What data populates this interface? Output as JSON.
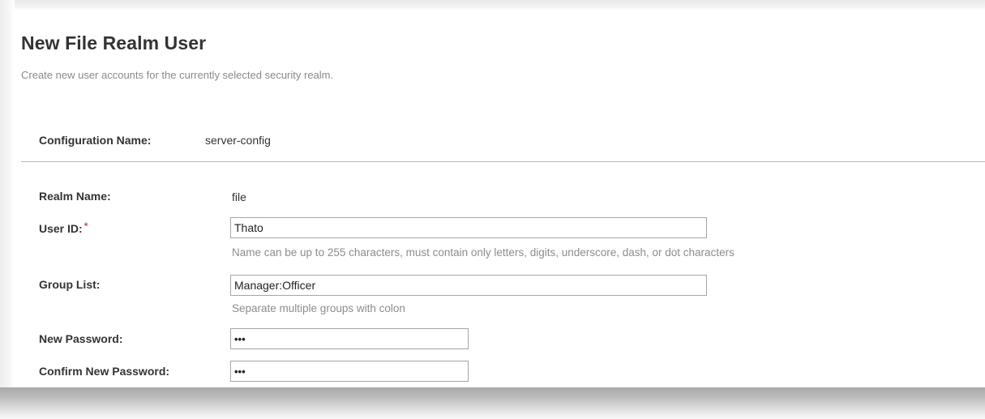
{
  "page": {
    "title": "New File Realm User",
    "description": "Create new user accounts for the currently selected security realm."
  },
  "configuration": {
    "label": "Configuration Name:",
    "value": "server-config"
  },
  "form": {
    "realm_name": {
      "label": "Realm Name:",
      "value": "file"
    },
    "user_id": {
      "label": "User ID:",
      "required_marker": "*",
      "value": "Thato",
      "help": "Name can be up to 255 characters, must contain only letters, digits, underscore, dash, or dot characters"
    },
    "group_list": {
      "label": "Group List:",
      "value": "Manager:Officer",
      "help": "Separate multiple groups with colon"
    },
    "new_password": {
      "label": "New Password:",
      "value": "•••"
    },
    "confirm_password": {
      "label": "Confirm New Password:",
      "value": "•••"
    }
  },
  "colors": {
    "required_star": "#d24b4b",
    "help_text": "#8d8d8d",
    "label_text": "#333333"
  }
}
